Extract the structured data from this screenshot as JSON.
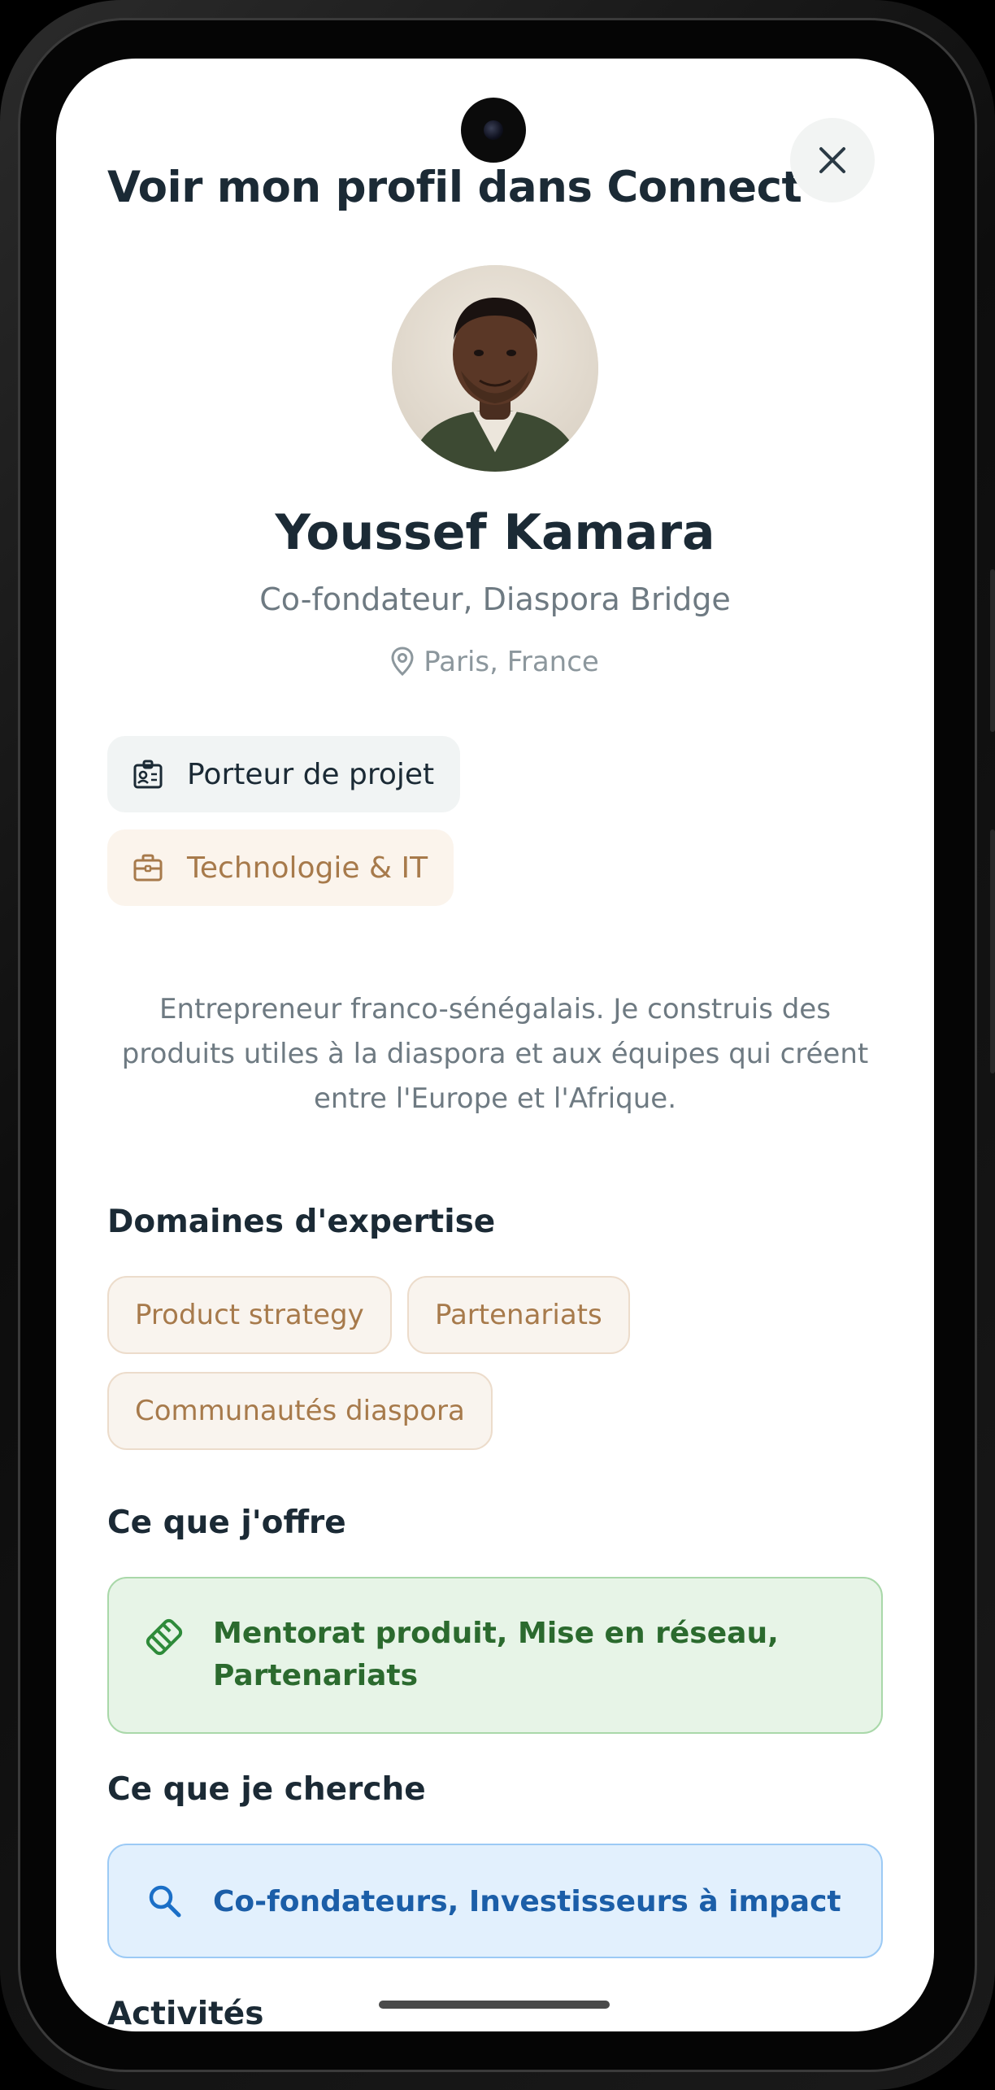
{
  "header": {
    "title": "Voir mon profil dans Connect",
    "close_icon": "close-icon"
  },
  "profile": {
    "name": "Youssef Kamara",
    "role": "Co-fondateur, Diaspora Bridge",
    "location": "Paris, France",
    "location_icon": "map-pin-icon",
    "bio": "Entrepreneur franco-sénégalais. Je construis des produits utiles à la diaspora et aux équipes qui créent entre l'Europe et l'Afrique."
  },
  "chips": {
    "profile_type": {
      "label": "Porteur de projet",
      "icon": "id-badge-icon"
    },
    "sector": {
      "label": "Technologie & IT",
      "icon": "briefcase-icon"
    }
  },
  "expertise": {
    "title": "Domaines d'expertise",
    "tags": [
      "Product strategy",
      "Partenariats",
      "Communautés diaspora"
    ]
  },
  "offer": {
    "title": "Ce que j'offre",
    "text": "Mentorat produit, Mise en réseau, Partenariats",
    "icon": "handshake-icon"
  },
  "seek": {
    "title": "Ce que je cherche",
    "text": "Co-fondateurs, Investisseurs à impact",
    "icon": "search-icon"
  },
  "activities": {
    "title": "Activités"
  },
  "colors": {
    "text_primary": "#1b2a35",
    "text_secondary": "#6e7a82",
    "accent_tan": "#a77a4b",
    "offer_green": "#2b6a2e",
    "seek_blue": "#1b5ea8"
  }
}
